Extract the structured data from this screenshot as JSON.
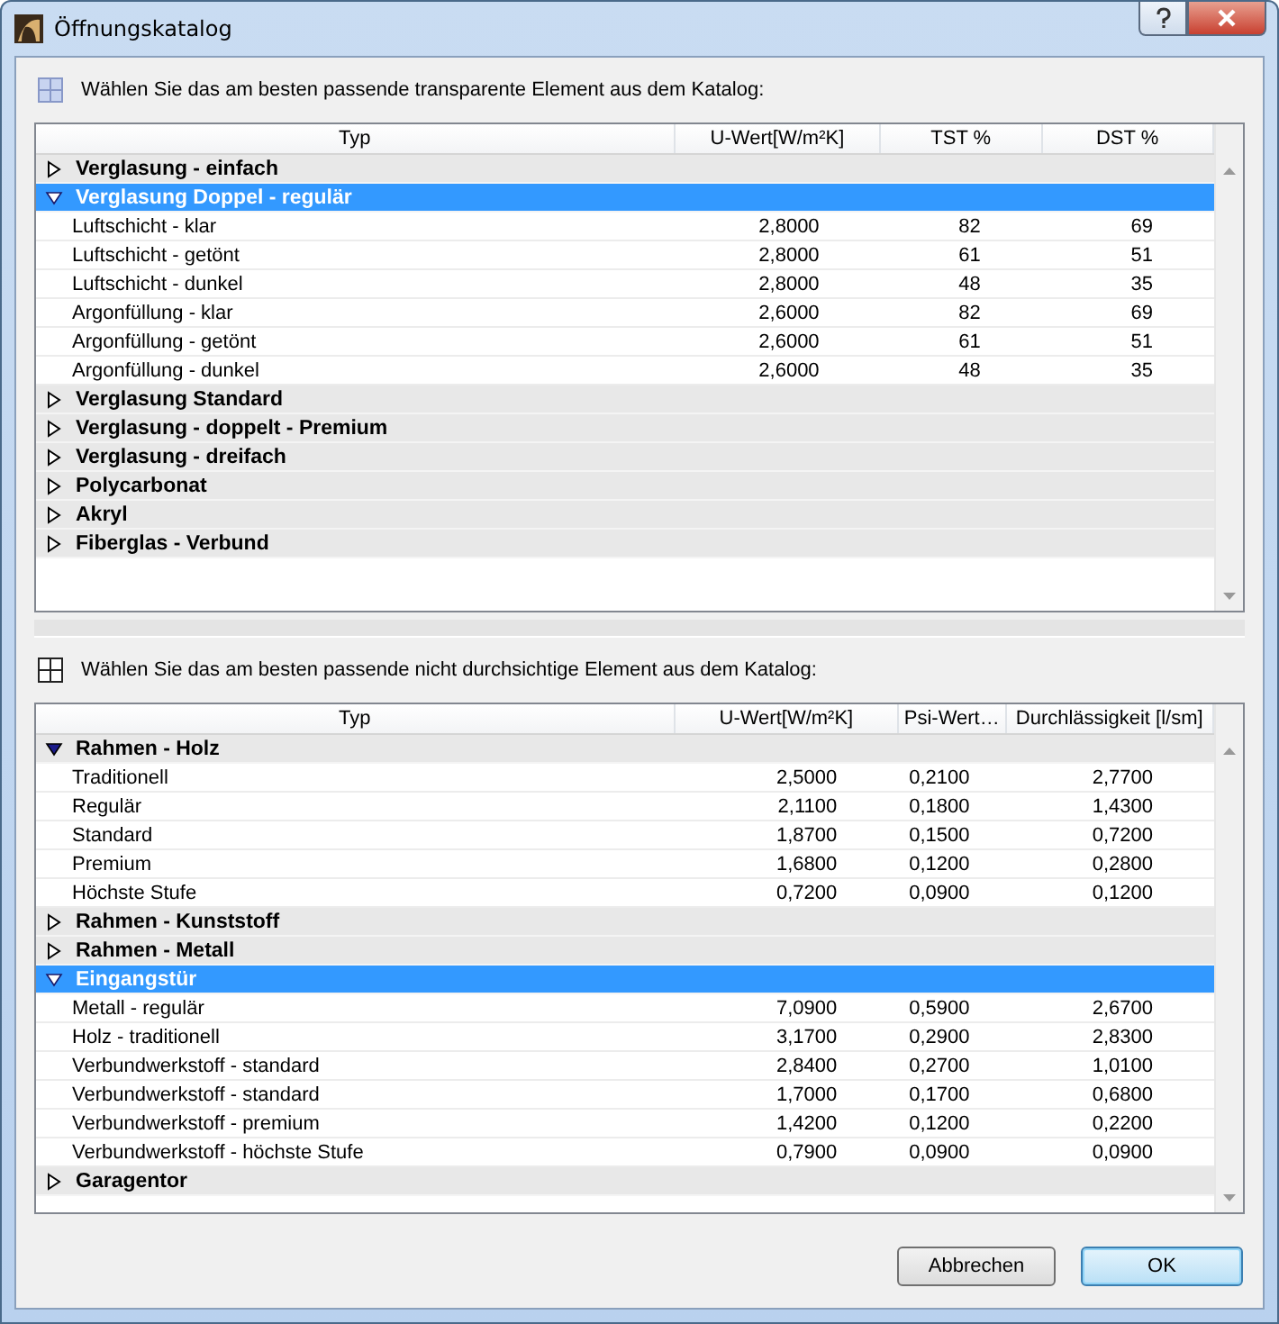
{
  "window": {
    "title": "Öffnungskatalog"
  },
  "transparent": {
    "caption": "Wählen Sie das am besten passende transparente Element aus dem Katalog:",
    "columns": [
      "Typ",
      "U-Wert[W/m²K]",
      "TST %",
      "DST %"
    ],
    "groups": [
      {
        "name": "Verglasung - einfach",
        "expanded": false,
        "selected": false
      },
      {
        "name": "Verglasung  Doppel - regulär",
        "expanded": true,
        "selected": true,
        "rows": [
          {
            "cells": [
              "Luftschicht - klar",
              "2,8000",
              "82",
              "69"
            ]
          },
          {
            "cells": [
              "Luftschicht - getönt",
              "2,8000",
              "61",
              "51"
            ]
          },
          {
            "cells": [
              "Luftschicht - dunkel",
              "2,8000",
              "48",
              "35"
            ]
          },
          {
            "cells": [
              "Argonfüllung - klar",
              "2,6000",
              "82",
              "69"
            ]
          },
          {
            "cells": [
              "Argonfüllung - getönt",
              "2,6000",
              "61",
              "51"
            ]
          },
          {
            "cells": [
              "Argonfüllung - dunkel",
              "2,6000",
              "48",
              "35"
            ]
          }
        ]
      },
      {
        "name": "Verglasung  Standard",
        "expanded": false,
        "selected": false
      },
      {
        "name": "Verglasung - doppelt - Premium",
        "expanded": false,
        "selected": false
      },
      {
        "name": "Verglasung - dreifach",
        "expanded": false,
        "selected": false
      },
      {
        "name": "Polycarbonat",
        "expanded": false,
        "selected": false
      },
      {
        "name": "Akryl",
        "expanded": false,
        "selected": false
      },
      {
        "name": "Fiberglas - Verbund",
        "expanded": false,
        "selected": false
      }
    ]
  },
  "opaque": {
    "caption": "Wählen Sie das am besten passende nicht durchsichtige Element aus dem Katalog:",
    "columns": [
      "Typ",
      "U-Wert[W/m²K]",
      "Psi-Wert…",
      "Durchlässigkeit [l/sm]"
    ],
    "groups": [
      {
        "name": "Rahmen - Holz",
        "expanded": true,
        "selected": false,
        "rows": [
          {
            "cells": [
              "Traditionell",
              "2,5000",
              "0,2100",
              "2,7700"
            ]
          },
          {
            "cells": [
              "Regulär",
              "2,1100",
              "0,1800",
              "1,4300"
            ]
          },
          {
            "cells": [
              "Standard",
              "1,8700",
              "0,1500",
              "0,7200"
            ]
          },
          {
            "cells": [
              "Premium",
              "1,6800",
              "0,1200",
              "0,2800"
            ]
          },
          {
            "cells": [
              "Höchste Stufe",
              "0,7200",
              "0,0900",
              "0,1200"
            ]
          }
        ]
      },
      {
        "name": "Rahmen - Kunststoff",
        "expanded": false,
        "selected": false
      },
      {
        "name": "Rahmen - Metall",
        "expanded": false,
        "selected": false
      },
      {
        "name": "Eingangstür",
        "expanded": true,
        "selected": true,
        "rows": [
          {
            "cells": [
              "Metall - regulär",
              "7,0900",
              "0,5900",
              "2,6700"
            ]
          },
          {
            "cells": [
              "Holz - traditionell",
              "3,1700",
              "0,2900",
              "2,8300"
            ]
          },
          {
            "cells": [
              "Verbundwerkstoff - standard",
              "2,8400",
              "0,2700",
              "1,0100"
            ]
          },
          {
            "cells": [
              "Verbundwerkstoff - standard",
              "1,7000",
              "0,1700",
              "0,6800"
            ]
          },
          {
            "cells": [
              "Verbundwerkstoff - premium",
              "1,4200",
              "0,1200",
              "0,2200"
            ]
          },
          {
            "cells": [
              "Verbundwerkstoff - höchste Stufe",
              "0,7900",
              "0,0900",
              "0,0900"
            ]
          }
        ]
      },
      {
        "name": "Garagentor",
        "expanded": false,
        "selected": false
      }
    ]
  },
  "buttons": [
    "Abbrechen",
    "OK"
  ]
}
